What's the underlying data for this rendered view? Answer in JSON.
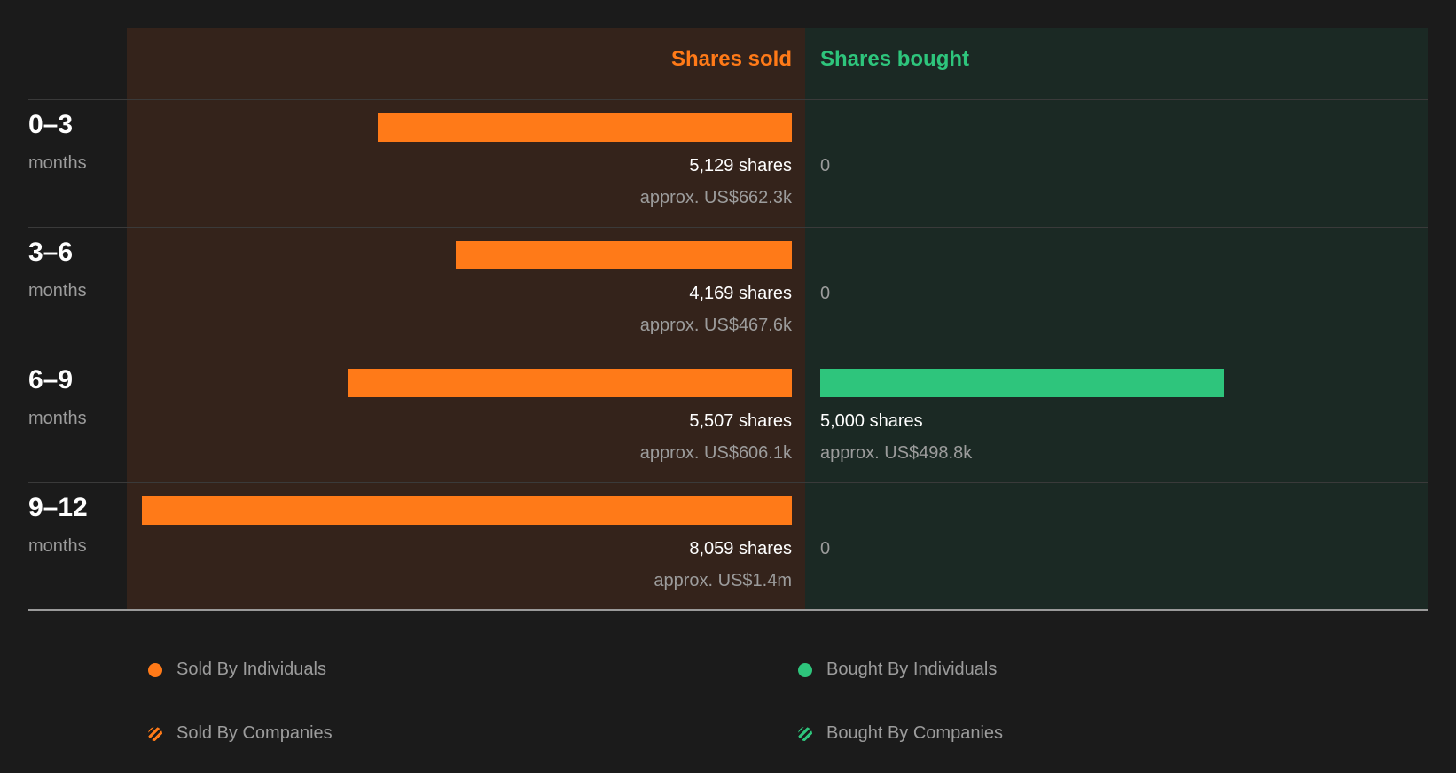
{
  "chart_data": {
    "type": "bar",
    "orientation": "diverging-horizontal",
    "headers": {
      "sold": "Shares sold",
      "bought": "Shares bought"
    },
    "categories": [
      {
        "label": "0–3",
        "sub": "months"
      },
      {
        "label": "3–6",
        "sub": "months"
      },
      {
        "label": "6–9",
        "sub": "months"
      },
      {
        "label": "9–12",
        "sub": "months"
      }
    ],
    "series": [
      {
        "name": "Shares sold",
        "color": "#ff7a18",
        "values": [
          5129,
          4169,
          5507,
          8059
        ],
        "share_labels": [
          "5,129 shares",
          "4,169 shares",
          "5,507 shares",
          "8,059 shares"
        ],
        "value_labels": [
          "approx. US$662.3k",
          "approx. US$467.6k",
          "approx. US$606.1k",
          "approx. US$1.4m"
        ]
      },
      {
        "name": "Shares bought",
        "color": "#2ec57c",
        "values": [
          0,
          0,
          5000,
          0
        ],
        "share_labels": [
          "0",
          "0",
          "5,000 shares",
          "0"
        ],
        "value_labels": [
          "",
          "",
          "approx. US$498.8k",
          ""
        ]
      }
    ],
    "xmax": 8059,
    "legend": [
      {
        "label": "Sold By Individuals",
        "color": "#ff7a18",
        "style": "solid"
      },
      {
        "label": "Bought By Individuals",
        "color": "#2ec57c",
        "style": "solid"
      },
      {
        "label": "Sold By Companies",
        "color": "#ff7a18",
        "style": "hatched"
      },
      {
        "label": "Bought By Companies",
        "color": "#2ec57c",
        "style": "hatched"
      }
    ],
    "legend_position": "bottom"
  }
}
